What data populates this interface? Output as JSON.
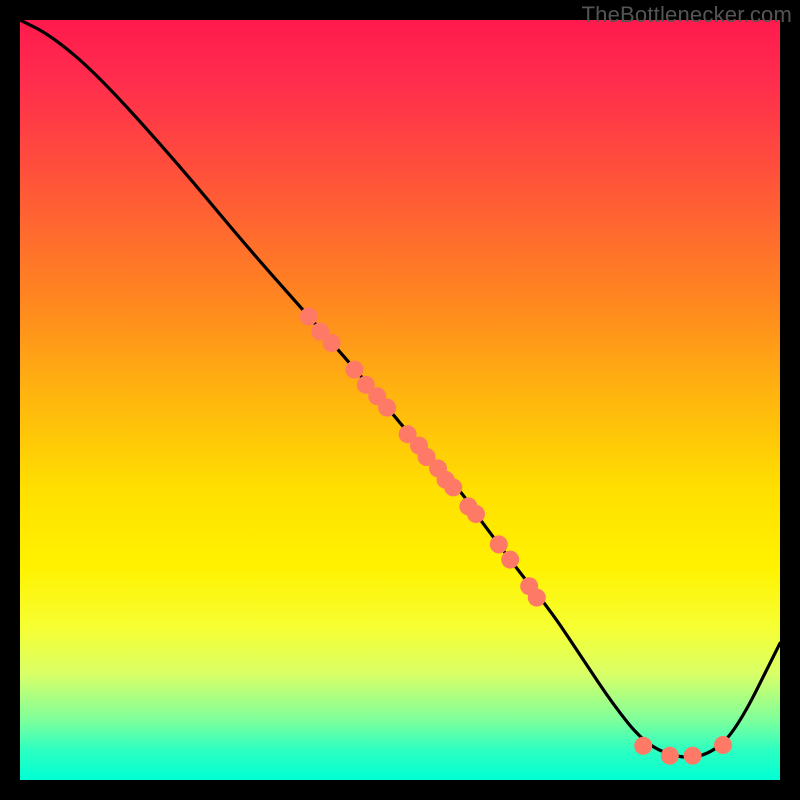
{
  "attribution": "TheBottlenecker.com",
  "chart_data": {
    "type": "line",
    "title": "",
    "xlabel": "",
    "ylabel": "",
    "xlim": [
      0,
      100
    ],
    "ylim": [
      0,
      100
    ],
    "series": [
      {
        "name": "curve",
        "x": [
          0,
          4,
          10,
          20,
          30,
          38,
          45,
          50,
          55,
          58,
          60,
          63,
          66,
          70,
          74,
          78,
          82,
          86,
          90,
          94,
          100
        ],
        "y": [
          100,
          98,
          93,
          82,
          70,
          61,
          53,
          47,
          41,
          38,
          35,
          31,
          27,
          22,
          16,
          10,
          5,
          3,
          3,
          6,
          18
        ]
      }
    ],
    "scatter_points": {
      "name": "markers",
      "color": "#ff7a66",
      "points": [
        {
          "x": 38,
          "y": 61
        },
        {
          "x": 39.5,
          "y": 59
        },
        {
          "x": 41,
          "y": 57.5
        },
        {
          "x": 44,
          "y": 54
        },
        {
          "x": 45.5,
          "y": 52
        },
        {
          "x": 47,
          "y": 50.5
        },
        {
          "x": 48.3,
          "y": 49
        },
        {
          "x": 51,
          "y": 45.5
        },
        {
          "x": 52.5,
          "y": 44
        },
        {
          "x": 53.5,
          "y": 42.5
        },
        {
          "x": 55,
          "y": 41
        },
        {
          "x": 56,
          "y": 39.5
        },
        {
          "x": 57,
          "y": 38.5
        },
        {
          "x": 59,
          "y": 36
        },
        {
          "x": 60,
          "y": 35
        },
        {
          "x": 63,
          "y": 31
        },
        {
          "x": 64.5,
          "y": 29
        },
        {
          "x": 67,
          "y": 25.5
        },
        {
          "x": 68,
          "y": 24
        },
        {
          "x": 82,
          "y": 4.5
        },
        {
          "x": 85.5,
          "y": 3.2
        },
        {
          "x": 88.5,
          "y": 3.2
        },
        {
          "x": 92.5,
          "y": 4.6
        }
      ]
    },
    "gradient_stops": [
      {
        "pos": 0.0,
        "color": "#ff1a4d"
      },
      {
        "pos": 0.5,
        "color": "#ffb70e"
      },
      {
        "pos": 0.8,
        "color": "#f6ff33"
      },
      {
        "pos": 1.0,
        "color": "#00ffd5"
      }
    ]
  }
}
